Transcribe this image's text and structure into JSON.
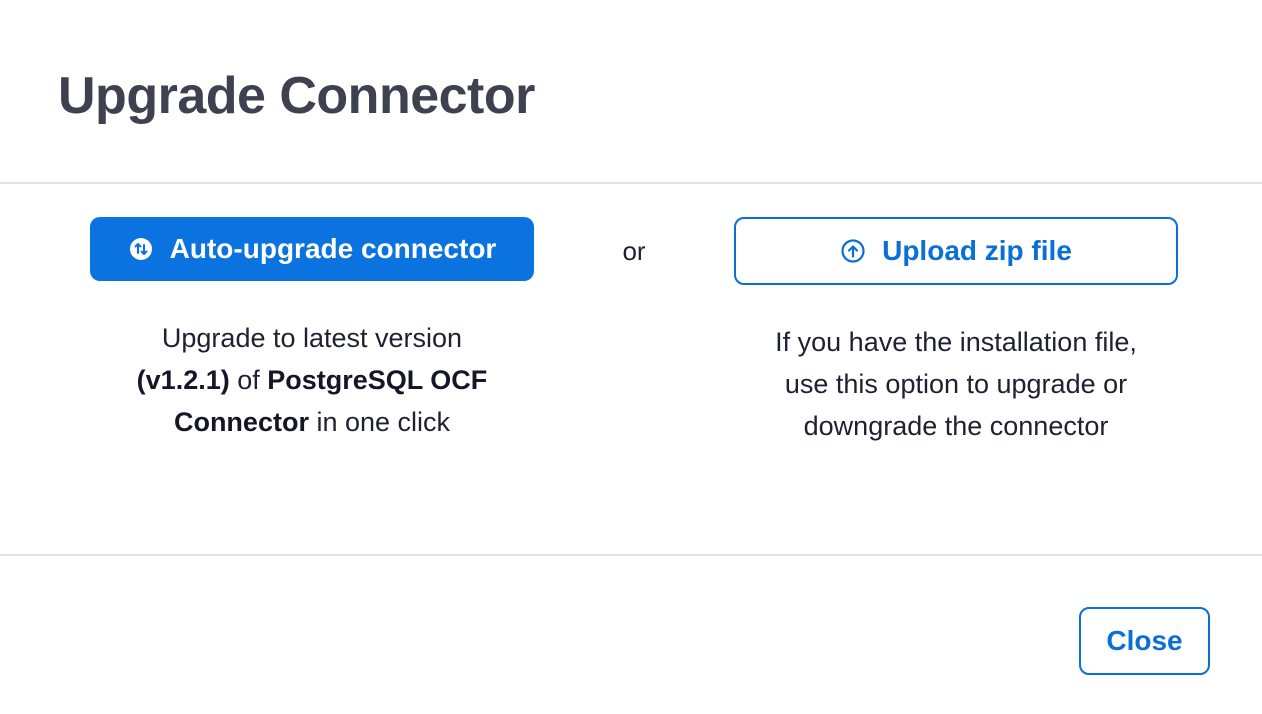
{
  "dialog": {
    "title": "Upgrade Connector"
  },
  "auto_upgrade": {
    "button_label": "Auto-upgrade connector",
    "icon": "sync-arrows-icon",
    "description": {
      "line1": "Upgrade to latest version",
      "version": "(v1.2.1)",
      "of": " of ",
      "connector_name_1": "PostgreSQL OCF",
      "connector_name_2": "Connector",
      "suffix": " in one click"
    }
  },
  "separator": {
    "text": "or"
  },
  "upload": {
    "button_label": "Upload zip file",
    "icon": "upload-arrow-circle-icon",
    "description": {
      "line1": "If you have the installation file,",
      "line2": "use this option to upgrade or",
      "line3": "downgrade the connector"
    }
  },
  "footer": {
    "close_label": "Close"
  },
  "colors": {
    "primary": "#0a73e0",
    "outline": "#0a6fd6",
    "title": "#3e4150",
    "divider": "#dde3ea"
  }
}
